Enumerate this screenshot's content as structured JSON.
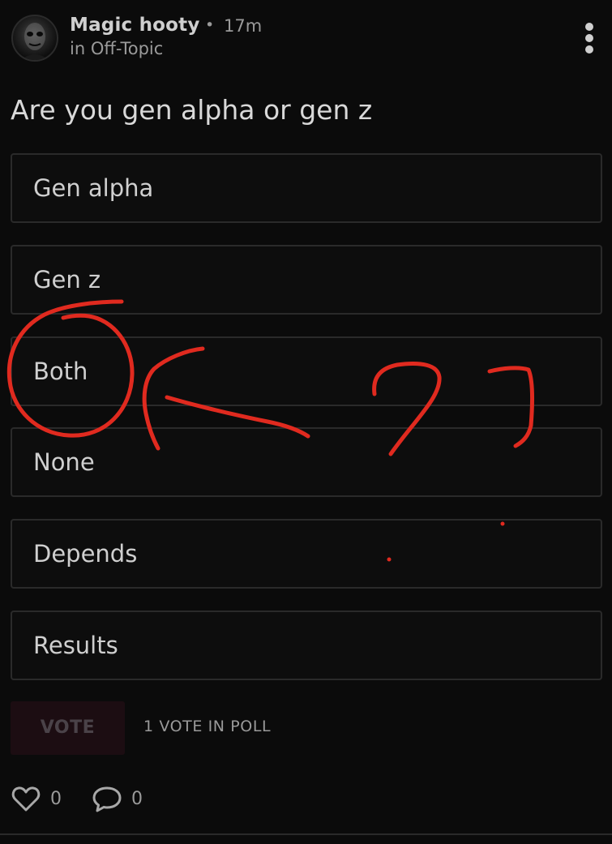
{
  "post": {
    "author": "Magic hooty",
    "separator": "•",
    "time": "17m",
    "community": "in Off-Topic",
    "more_icon": "more-vertical-icon"
  },
  "poll": {
    "question": "Are you gen alpha or gen z",
    "options": [
      {
        "label": "Gen alpha"
      },
      {
        "label": "Gen z"
      },
      {
        "label": "Both"
      },
      {
        "label": "None"
      },
      {
        "label": "Depends"
      },
      {
        "label": "Results"
      }
    ],
    "vote_label": "VOTE",
    "vote_count_text": "1 VOTE IN POLL"
  },
  "actions": {
    "likes": "0",
    "comments": "0",
    "like_icon": "heart-icon",
    "comment_icon": "comment-bubble-icon"
  },
  "annotation": {
    "color": "#e02a1f",
    "marks": [
      "circle-around-both",
      "arrow-pointing-left",
      "question-mark-1",
      "question-mark-2"
    ]
  },
  "colors": {
    "background": "#0b0b0b",
    "option_border": "#2a2a2a",
    "vote_button_bg": "#1c0d12"
  }
}
